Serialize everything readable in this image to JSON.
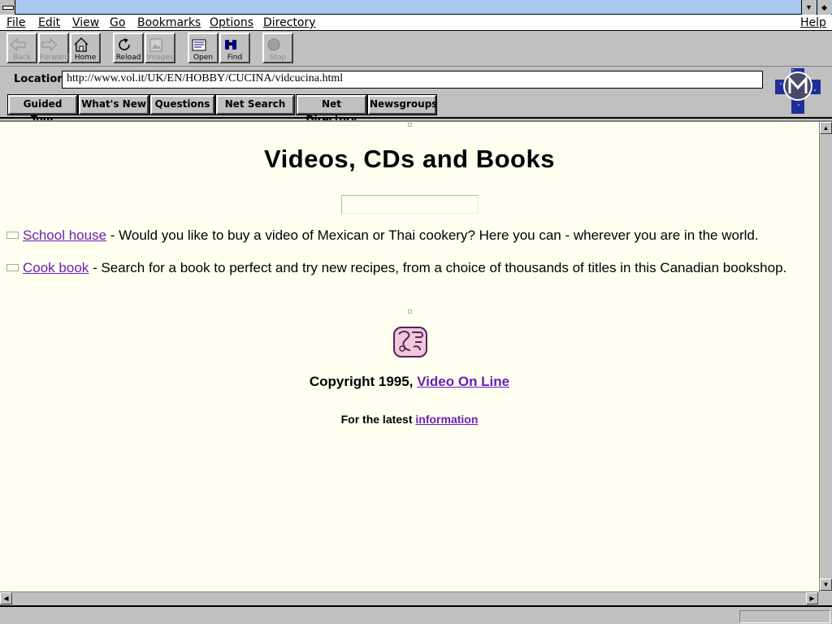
{
  "menu": {
    "file": "File",
    "edit": "Edit",
    "view": "View",
    "go": "Go",
    "bookmarks": "Bookmarks",
    "options": "Options",
    "directory": "Directory",
    "help": "Help"
  },
  "toolbar": {
    "back": "Back",
    "forward": "Forward",
    "home": "Home",
    "reload": "Reload",
    "images": "Images",
    "open": "Open",
    "find": "Find",
    "stop": "Stop"
  },
  "location": {
    "label": "Location:",
    "url": "http://www.vol.it/UK/EN/HOBBY/CUCINA/vidcucina.html"
  },
  "directory_buttons": {
    "guided_tour": "Guided Tour",
    "whats_new": "What's New",
    "questions": "Questions",
    "net_search": "Net Search",
    "net_directory": "Net Directory",
    "newsgroups": "Newsgroups"
  },
  "page": {
    "title": "Videos, CDs and Books",
    "items": [
      {
        "link": "School house",
        "text": " - Would you like to buy a video of Mexican or Thai cookery? Here you can - wherever you are in the world."
      },
      {
        "link": "Cook book",
        "text": " - Search for a book to perfect and try new recipes, from a choice of thousands of titles in this Canadian bookshop."
      }
    ],
    "copyright_text": "Copyright 1995, ",
    "copyright_link": "Video On Line",
    "latest_text": "For the latest ",
    "latest_link": "information"
  },
  "colors": {
    "page_background": "#fffff0",
    "link": "#6a1fb8",
    "title_bar": "#a8c8f0",
    "chrome": "#c0c0c0"
  },
  "icons": {
    "logo": "mosaic-m-logo",
    "footer": "mayan-glyph-icon"
  }
}
